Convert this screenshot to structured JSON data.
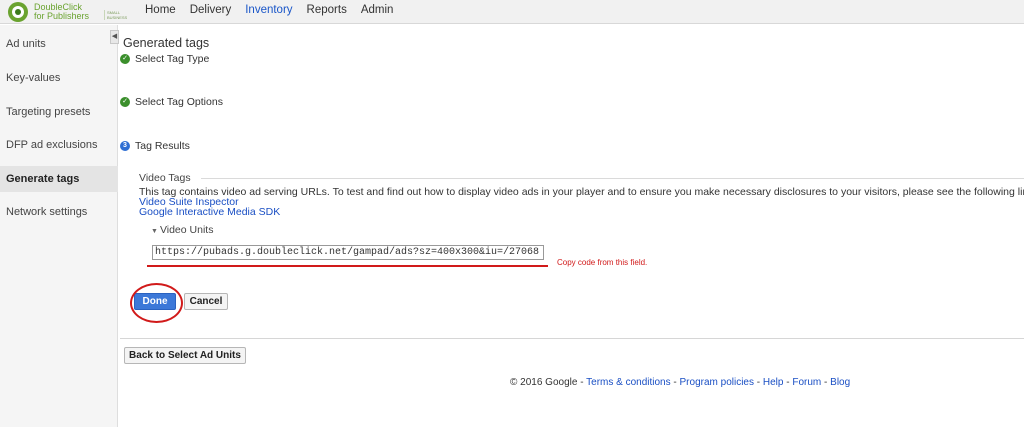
{
  "brand": {
    "line1": "DoubleClick",
    "line2": "for Publishers",
    "edition": "SMALL BUSINESS",
    "color": "#6aa32f"
  },
  "nav": {
    "items": [
      "Home",
      "Delivery",
      "Inventory",
      "Reports",
      "Admin"
    ],
    "active": "Inventory",
    "active_color": "#1a56c8"
  },
  "sidebar": {
    "items": [
      "Ad units",
      "Key-values",
      "Targeting presets",
      "DFP ad exclusions",
      "Generate tags",
      "Network settings"
    ],
    "selected": "Generate tags",
    "collapse_icon": "chevron-left-icon"
  },
  "page": {
    "title": "Generated tags",
    "steps": [
      {
        "label": "Select Tag Type",
        "status": "done",
        "icon": "check-circle-icon"
      },
      {
        "label": "Select Tag Options",
        "status": "done",
        "icon": "check-circle-icon"
      },
      {
        "label": "Tag Results",
        "status": "current",
        "number": "3"
      }
    ]
  },
  "video_tags": {
    "legend": "Video Tags",
    "info": "This tag contains video ad serving URLs. To test and find out how to display video ads in your player and to ensure you make necessary disclosures to your visitors, please see the following links:",
    "links": [
      "Video Suite Inspector",
      "Google Interactive Media SDK"
    ],
    "units_toggle": "Video Units",
    "code_value": "https://pubads.g.doubleclick.net/gampad/ads?sz=400x300&iu=/27068",
    "annotation": "Copy code from this field.",
    "annotation_color": "#d11a1a"
  },
  "buttons": {
    "done": "Done",
    "cancel": "Cancel",
    "back": "Back to Select Ad Units",
    "primary_color": "#3c78d8"
  },
  "footer": {
    "copyright": "© 2016 Google",
    "sep": " - ",
    "links": [
      "Terms & conditions",
      "Program policies",
      "Help",
      "Forum",
      "Blog"
    ]
  }
}
